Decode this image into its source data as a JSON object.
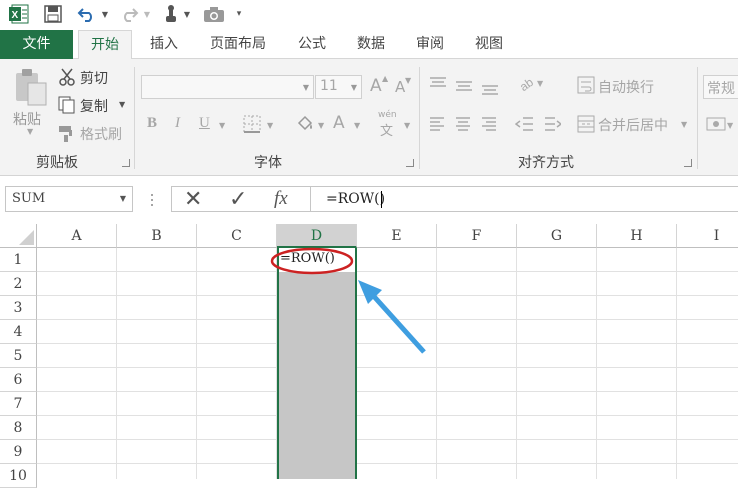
{
  "qat": {
    "excel_icon": "excel-logo-icon",
    "save_icon": "save-icon",
    "undo_icon": "undo-icon",
    "redo_icon": "redo-icon",
    "touch_icon": "touch-mode-icon",
    "camera_icon": "camera-icon",
    "customize_icon": "customize-qat-icon"
  },
  "tabs": [
    {
      "label": "文件"
    },
    {
      "label": "开始"
    },
    {
      "label": "插入"
    },
    {
      "label": "页面布局"
    },
    {
      "label": "公式"
    },
    {
      "label": "数据"
    },
    {
      "label": "审阅"
    },
    {
      "label": "视图"
    }
  ],
  "ribbon": {
    "clipboard": {
      "paste": "粘贴",
      "cut": "剪切",
      "copy": "复制",
      "format_painter": "格式刷",
      "group_label": "剪贴板"
    },
    "font": {
      "font_name": "",
      "font_size": "11",
      "bold": "B",
      "italic": "I",
      "underline": "U",
      "font_color": "A",
      "phonetic": "wén",
      "phonetic_char": "文",
      "grow": "A",
      "shrink": "A",
      "group_label": "字体"
    },
    "alignment": {
      "wrap_text": "自动换行",
      "merge_center": "合并后居中",
      "group_label": "对齐方式"
    },
    "number": {
      "format": "常规"
    }
  },
  "formula_bar": {
    "name_box": "SUM",
    "cancel": "✕",
    "enter": "✓",
    "fx": "fx",
    "formula": "=ROW()"
  },
  "sheet": {
    "columns": [
      "A",
      "B",
      "C",
      "D",
      "E",
      "F",
      "G",
      "H",
      "I"
    ],
    "rows": [
      "1",
      "2",
      "3",
      "4",
      "5",
      "6",
      "7",
      "8",
      "9",
      "10"
    ],
    "active_cell_text": "=ROW()",
    "selected_column": "D"
  },
  "colors": {
    "excel_green": "#217346",
    "highlight_red": "#cc2222",
    "arrow_blue": "#3f9ee0",
    "selection_gray": "#c6c6c6"
  }
}
